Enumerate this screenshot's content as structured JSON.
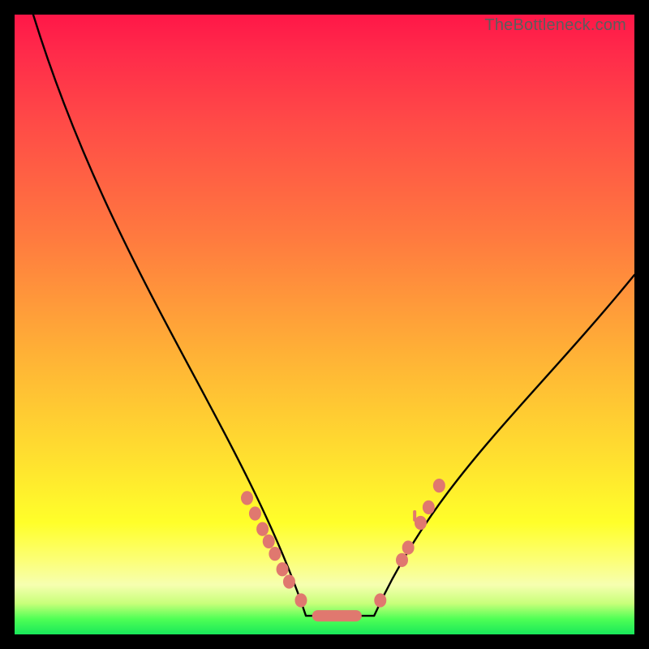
{
  "watermark": "TheBottleneck.com",
  "chart_data": {
    "type": "line",
    "title": "",
    "xlabel": "",
    "ylabel": "",
    "xlim": [
      0,
      100
    ],
    "ylim": [
      0,
      100
    ],
    "grid": false,
    "legend": false,
    "curve": {
      "left_start": {
        "x": 3,
        "y": 100
      },
      "valley_left": {
        "x": 47,
        "y": 3
      },
      "valley_right": {
        "x": 58,
        "y": 3
      },
      "right_end": {
        "x": 100,
        "y": 58
      }
    },
    "markers_left": [
      {
        "x": 37.5,
        "y": 22
      },
      {
        "x": 38.8,
        "y": 19.5
      },
      {
        "x": 40.0,
        "y": 17
      },
      {
        "x": 41.0,
        "y": 15
      },
      {
        "x": 42.0,
        "y": 13
      },
      {
        "x": 43.2,
        "y": 10.5
      },
      {
        "x": 44.3,
        "y": 8.5
      },
      {
        "x": 46.2,
        "y": 5.5
      }
    ],
    "valley_pill": {
      "x0": 48,
      "x1": 56,
      "y": 3
    },
    "markers_right": [
      {
        "x": 59.0,
        "y": 5.5
      },
      {
        "x": 62.5,
        "y": 12
      },
      {
        "x": 63.5,
        "y": 14
      },
      {
        "x": 65.5,
        "y": 18
      },
      {
        "x": 66.8,
        "y": 20.5
      },
      {
        "x": 68.5,
        "y": 24
      }
    ],
    "extra_mark": {
      "x": 63.5,
      "y": 19
    }
  }
}
